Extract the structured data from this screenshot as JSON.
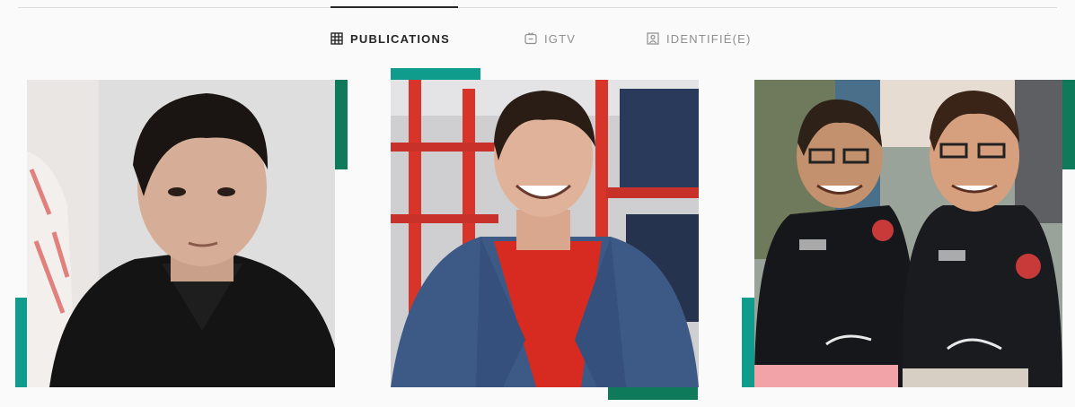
{
  "tabs": [
    {
      "label": "PUBLICATIONS",
      "icon": "grid-icon",
      "active": true
    },
    {
      "label": "IGTV",
      "icon": "igtv-icon",
      "active": false
    },
    {
      "label": "IDENTIFIÉ(E)",
      "icon": "tagged-icon",
      "active": false
    }
  ],
  "colors": {
    "accent_teal": "#109c8c",
    "accent_green": "#0f7a5a",
    "active_tab": "#262626",
    "inactive_tab": "#8e8e8e"
  },
  "posts": [
    {
      "subject": "portrait of young man with dark hair in black shirt"
    },
    {
      "subject": "smiling man in blue blazer and red t-shirt in front of jeans shelves"
    },
    {
      "subject": "two smiling men in black polo shirts with arms around each other"
    }
  ]
}
